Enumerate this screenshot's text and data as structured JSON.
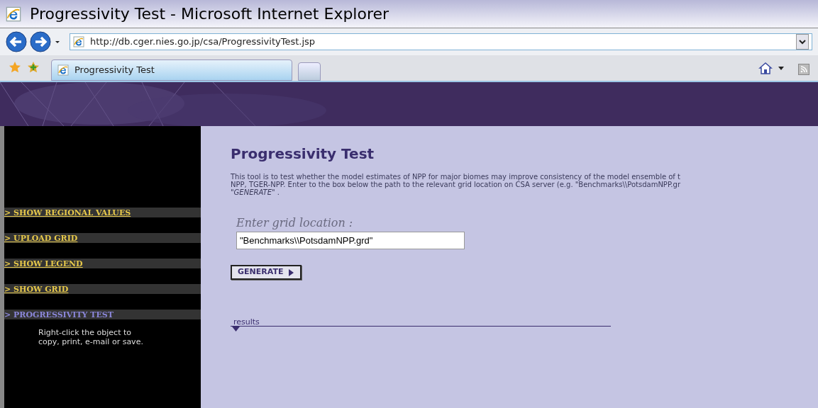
{
  "window": {
    "title": "Progressivity Test - Microsoft Internet Explorer"
  },
  "address_bar": {
    "url": "http://db.cger.nies.go.jp/csa/ProgressivityTest.jsp"
  },
  "tabs": [
    {
      "label": "Progressivity Test",
      "selected": true
    }
  ],
  "sidebar": {
    "items": [
      {
        "label": "> SHOW REGIONAL VALUES",
        "selected": false
      },
      {
        "label": "> UPLOAD GRID",
        "selected": false
      },
      {
        "label": "> SHOW LEGEND",
        "selected": false
      },
      {
        "label": "> SHOW GRID",
        "selected": false
      },
      {
        "label": "> PROGRESSIVITY TEST",
        "selected": true
      }
    ],
    "note": [
      "Right-click the object to",
      "copy, print, e-mail or save."
    ]
  },
  "content": {
    "heading": "Progressivity Test",
    "description": [
      "This tool is to test whether the model estimates of NPP for major biomes may improve consistency of the model ensemble of t",
      "NPP, TGER-NPP. Enter to the box below the path to the relevant grid location on CSA server (e.g. \"Benchmarks\\\\PotsdamNPP.gr",
      "*\"GENERATE\"* ."
    ],
    "field": {
      "label": "Enter grid location :",
      "value": "\"Benchmarks\\\\PotsdamNPP.grd\""
    },
    "button": "GENERATE",
    "results_label": "results"
  }
}
